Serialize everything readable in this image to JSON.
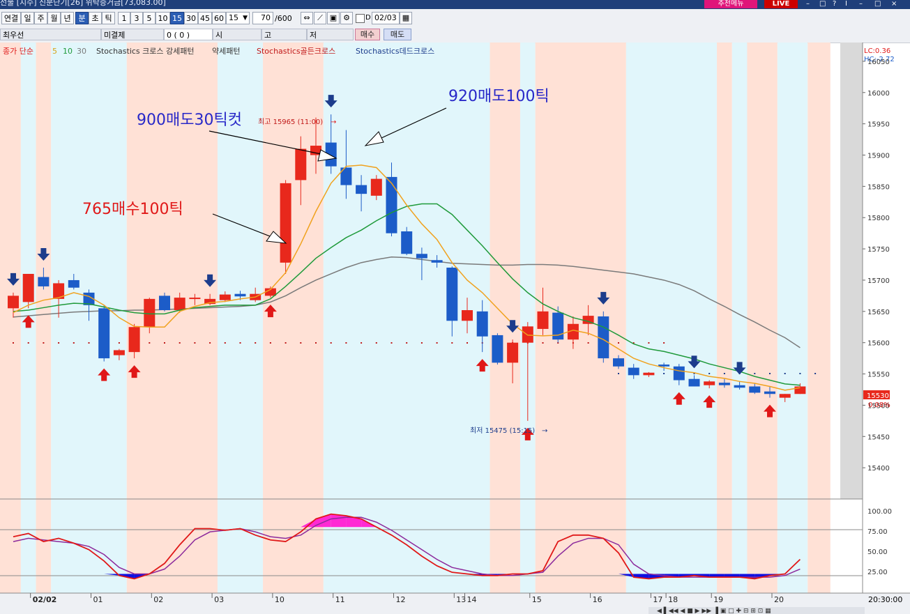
{
  "window": {
    "title": "선물 [지수] 신분단기[26] 위탁증거금[73,083.00]",
    "recommend_label": "추천메뉴",
    "live_label": "LIVE",
    "controls": [
      "–",
      "□",
      "?",
      "I",
      "–",
      "□",
      "×"
    ]
  },
  "toolbar": {
    "period_buttons": [
      "연결",
      "일",
      "주",
      "월",
      "년",
      "분",
      "초",
      "틱"
    ],
    "selected_period": "분",
    "interval_buttons": [
      "1",
      "3",
      "5",
      "10",
      "15",
      "30",
      "45",
      "60"
    ],
    "selected_interval": "15",
    "interval_select": "15",
    "count_value": "70",
    "count_total": "/600",
    "date_value": "02/03",
    "checkbox_label": "D"
  },
  "info_row": {
    "spread_label": "최우선",
    "open_interest_label": "미결제",
    "open_interest_value": "0 (     0     )",
    "ohl_labels": [
      "시",
      "고",
      "저"
    ],
    "buy_button": "매수",
    "sell_button": "매도"
  },
  "legend": {
    "base": "종가 단순",
    "ma_periods": [
      "5",
      "10",
      "30"
    ],
    "items": [
      "Stochastics 크로스 강세패턴",
      "약세패턴",
      "Stochastics골든크로스",
      "Stochastics데드크로스"
    ],
    "right_top": [
      "LC:0.36",
      "HC:-2.72"
    ]
  },
  "annotations": {
    "buy_765": "765매수100틱",
    "sell_900": "900매도30틱컷",
    "sell_920": "920매도100틱",
    "high_label": "최고 15965 (11:00)",
    "low_label": "최저 15475 (15:15)"
  },
  "price_axis": {
    "ticks": [
      "16050",
      "16000",
      "15950",
      "15900",
      "15850",
      "15800",
      "15750",
      "15700",
      "15650",
      "15600",
      "15550",
      "15500",
      "15450",
      "15400"
    ],
    "current_price": "15530",
    "current_change": "0.08%"
  },
  "osc_axis": {
    "ticks": [
      "100.00",
      "75.00",
      "50.00",
      "25.00"
    ]
  },
  "time_axis": {
    "labels": [
      "02/02",
      "01",
      "02",
      "03",
      "10",
      "11",
      "12",
      "13",
      "14",
      "15",
      "16",
      "17",
      "18",
      "19",
      "20"
    ],
    "clock": "20:30:00"
  },
  "colors": {
    "up": "#e8281c",
    "down": "#1c5cc8",
    "ma5": "#f0a21e",
    "ma10": "#1f9a3a",
    "ma30": "#7a7a7a",
    "bg_up_zone": "#ffe1d6",
    "bg_down_zone": "#e1f6fb",
    "stoch_k": "#e01818",
    "stoch_d": "#8c2a9c",
    "overbought_fill": "#ff2ad4",
    "oversold_fill": "#1010e0"
  },
  "chart_data": {
    "type": "candlestick",
    "y_range": [
      15350,
      16080
    ],
    "candles": [
      {
        "o": 15655,
        "h": 15680,
        "l": 15640,
        "c": 15675
      },
      {
        "o": 15665,
        "h": 15710,
        "l": 15655,
        "c": 15710
      },
      {
        "o": 15705,
        "h": 15720,
        "l": 15685,
        "c": 15690
      },
      {
        "o": 15670,
        "h": 15700,
        "l": 15640,
        "c": 15695
      },
      {
        "o": 15700,
        "h": 15710,
        "l": 15685,
        "c": 15688
      },
      {
        "o": 15680,
        "h": 15685,
        "l": 15635,
        "c": 15660
      },
      {
        "o": 15655,
        "h": 15660,
        "l": 15570,
        "c": 15575
      },
      {
        "o": 15580,
        "h": 15590,
        "l": 15572,
        "c": 15588
      },
      {
        "o": 15585,
        "h": 15630,
        "l": 15575,
        "c": 15625
      },
      {
        "o": 15625,
        "h": 15672,
        "l": 15615,
        "c": 15670
      },
      {
        "o": 15675,
        "h": 15680,
        "l": 15650,
        "c": 15652
      },
      {
        "o": 15652,
        "h": 15680,
        "l": 15648,
        "c": 15672
      },
      {
        "o": 15670,
        "h": 15678,
        "l": 15660,
        "c": 15672
      },
      {
        "o": 15662,
        "h": 15678,
        "l": 15660,
        "c": 15670
      },
      {
        "o": 15668,
        "h": 15682,
        "l": 15665,
        "c": 15677
      },
      {
        "o": 15678,
        "h": 15683,
        "l": 15668,
        "c": 15674
      },
      {
        "o": 15668,
        "h": 15688,
        "l": 15665,
        "c": 15678
      },
      {
        "o": 15675,
        "h": 15690,
        "l": 15672,
        "c": 15687
      },
      {
        "o": 15728,
        "h": 15860,
        "l": 15710,
        "c": 15855
      },
      {
        "o": 15860,
        "h": 15930,
        "l": 15820,
        "c": 15910
      },
      {
        "o": 15900,
        "h": 15960,
        "l": 15870,
        "c": 15915
      },
      {
        "o": 15920,
        "h": 15965,
        "l": 15870,
        "c": 15882
      },
      {
        "o": 15880,
        "h": 15940,
        "l": 15830,
        "c": 15852
      },
      {
        "o": 15852,
        "h": 15868,
        "l": 15810,
        "c": 15838
      },
      {
        "o": 15835,
        "h": 15868,
        "l": 15828,
        "c": 15862
      },
      {
        "o": 15865,
        "h": 15888,
        "l": 15770,
        "c": 15775
      },
      {
        "o": 15778,
        "h": 15785,
        "l": 15740,
        "c": 15742
      },
      {
        "o": 15742,
        "h": 15752,
        "l": 15700,
        "c": 15735
      },
      {
        "o": 15732,
        "h": 15740,
        "l": 15720,
        "c": 15728
      },
      {
        "o": 15720,
        "h": 15722,
        "l": 15610,
        "c": 15635
      },
      {
        "o": 15635,
        "h": 15672,
        "l": 15615,
        "c": 15652
      },
      {
        "o": 15650,
        "h": 15668,
        "l": 15585,
        "c": 15610
      },
      {
        "o": 15612,
        "h": 15615,
        "l": 15565,
        "c": 15568
      },
      {
        "o": 15568,
        "h": 15605,
        "l": 15535,
        "c": 15600
      },
      {
        "o": 15600,
        "h": 15633,
        "l": 15475,
        "c": 15626
      },
      {
        "o": 15622,
        "h": 15688,
        "l": 15612,
        "c": 15650
      },
      {
        "o": 15648,
        "h": 15658,
        "l": 15600,
        "c": 15605
      },
      {
        "o": 15605,
        "h": 15642,
        "l": 15590,
        "c": 15630
      },
      {
        "o": 15630,
        "h": 15660,
        "l": 15612,
        "c": 15643
      },
      {
        "o": 15642,
        "h": 15650,
        "l": 15568,
        "c": 15575
      },
      {
        "o": 15575,
        "h": 15580,
        "l": 15558,
        "c": 15562
      },
      {
        "o": 15560,
        "h": 15566,
        "l": 15542,
        "c": 15548
      },
      {
        "o": 15548,
        "h": 15553,
        "l": 15545,
        "c": 15552
      },
      {
        "o": 15565,
        "h": 15568,
        "l": 15555,
        "c": 15562
      },
      {
        "o": 15562,
        "h": 15566,
        "l": 15532,
        "c": 15540
      },
      {
        "o": 15542,
        "h": 15548,
        "l": 15530,
        "c": 15530
      },
      {
        "o": 15532,
        "h": 15540,
        "l": 15527,
        "c": 15538
      },
      {
        "o": 15536,
        "h": 15542,
        "l": 15528,
        "c": 15532
      },
      {
        "o": 15532,
        "h": 15538,
        "l": 15525,
        "c": 15528
      },
      {
        "o": 15530,
        "h": 15535,
        "l": 15518,
        "c": 15520
      },
      {
        "o": 15522,
        "h": 15530,
        "l": 15512,
        "c": 15518
      },
      {
        "o": 15512,
        "h": 15518,
        "l": 15505,
        "c": 15518
      },
      {
        "o": 15518,
        "h": 15535,
        "l": 15518,
        "c": 15530
      }
    ],
    "ma5": [
      15648,
      15660,
      15668,
      15672,
      15680,
      15674,
      15660,
      15640,
      15626,
      15625,
      15625,
      15650,
      15658,
      15664,
      15666,
      15670,
      15673,
      15685,
      15712,
      15758,
      15810,
      15855,
      15882,
      15884,
      15880,
      15855,
      15820,
      15790,
      15765,
      15728,
      15700,
      15680,
      15655,
      15630,
      15612,
      15611,
      15612,
      15620,
      15615,
      15605,
      15590,
      15575,
      15566,
      15560,
      15555,
      15552,
      15546,
      15543,
      15538,
      15535,
      15530,
      15524,
      15528
    ],
    "ma10": [
      15650,
      15652,
      15656,
      15660,
      15663,
      15662,
      15657,
      15652,
      15648,
      15646,
      15646,
      15652,
      15656,
      15658,
      15660,
      15660,
      15660,
      15670,
      15690,
      15712,
      15735,
      15752,
      15768,
      15780,
      15795,
      15808,
      15818,
      15822,
      15822,
      15805,
      15780,
      15755,
      15728,
      15702,
      15680,
      15662,
      15650,
      15640,
      15634,
      15625,
      15612,
      15598,
      15590,
      15586,
      15580,
      15574,
      15566,
      15560,
      15554,
      15546,
      15540,
      15534,
      15532
    ],
    "ma30": [
      15641,
      15643,
      15645,
      15647,
      15649,
      15650,
      15651,
      15651,
      15652,
      15652,
      15653,
      15654,
      15655,
      15656,
      15657,
      15658,
      15660,
      15665,
      15675,
      15688,
      15700,
      15710,
      15720,
      15728,
      15733,
      15737,
      15736,
      15733,
      15730,
      15727,
      15726,
      15725,
      15724,
      15724,
      15725,
      15725,
      15724,
      15722,
      15719,
      15716,
      15713,
      15710,
      15705,
      15700,
      15693,
      15683,
      15670,
      15658,
      15645,
      15633,
      15620,
      15608,
      15592
    ],
    "dots_red": [
      15610,
      15610,
      15610,
      15610,
      15610,
      15610,
      15610,
      15610,
      15610,
      15610,
      15610,
      15610,
      15610,
      15610,
      15610,
      15610,
      15610,
      15610,
      15610,
      15610,
      15610,
      15610,
      15610,
      15610,
      15610,
      15610,
      15610,
      15610,
      15610,
      15610,
      15610,
      15610,
      15610
    ],
    "up_arrows": [
      1,
      6,
      8,
      17,
      31,
      34,
      44,
      46,
      50
    ],
    "down_arrows": [
      0,
      2,
      13,
      21,
      33,
      39,
      45,
      48
    ],
    "zones": [
      {
        "from": 0,
        "to": 0.5,
        "type": "up"
      },
      {
        "from": 0.5,
        "to": 1.5,
        "type": "down"
      },
      {
        "from": 1.5,
        "to": 2.5,
        "type": "up"
      },
      {
        "from": 2.5,
        "to": 7.5,
        "type": "down"
      },
      {
        "from": 7.5,
        "to": 13.5,
        "type": "up"
      },
      {
        "from": 13.5,
        "to": 16.5,
        "type": "down"
      },
      {
        "from": 16.5,
        "to": 20.5,
        "type": "up"
      },
      {
        "from": 20.5,
        "to": 31.5,
        "type": "down"
      },
      {
        "from": 31.5,
        "to": 33.5,
        "type": "up"
      },
      {
        "from": 33.5,
        "to": 34.5,
        "type": "down"
      },
      {
        "from": 34.5,
        "to": 40.5,
        "type": "up"
      },
      {
        "from": 40.5,
        "to": 46.5,
        "type": "down"
      },
      {
        "from": 46.5,
        "to": 47.5,
        "type": "up"
      },
      {
        "from": 47.5,
        "to": 48.5,
        "type": "down"
      },
      {
        "from": 48.5,
        "to": 50.5,
        "type": "up"
      },
      {
        "from": 50.5,
        "to": 52.5,
        "type": "down"
      },
      {
        "from": 52.5,
        "to": 54,
        "type": "up"
      }
    ],
    "stoch_k": [
      68,
      72,
      62,
      66,
      60,
      52,
      38,
      20,
      16,
      22,
      35,
      58,
      78,
      78,
      76,
      78,
      70,
      64,
      62,
      74,
      90,
      96,
      94,
      90,
      80,
      70,
      58,
      44,
      32,
      24,
      22,
      20,
      20,
      22,
      22,
      26,
      62,
      70,
      70,
      66,
      48,
      18,
      16,
      18,
      18,
      20,
      18,
      18,
      18,
      16,
      20,
      22,
      40
    ],
    "stoch_d": [
      62,
      66,
      64,
      62,
      60,
      56,
      46,
      30,
      22,
      22,
      28,
      44,
      64,
      74,
      76,
      78,
      74,
      68,
      66,
      70,
      82,
      90,
      92,
      92,
      86,
      76,
      64,
      52,
      40,
      30,
      26,
      22,
      20,
      20,
      22,
      24,
      44,
      60,
      66,
      66,
      58,
      34,
      22,
      20,
      18,
      18,
      18,
      18,
      18,
      18,
      18,
      20,
      28
    ],
    "stoch_range": [
      0,
      100
    ]
  }
}
